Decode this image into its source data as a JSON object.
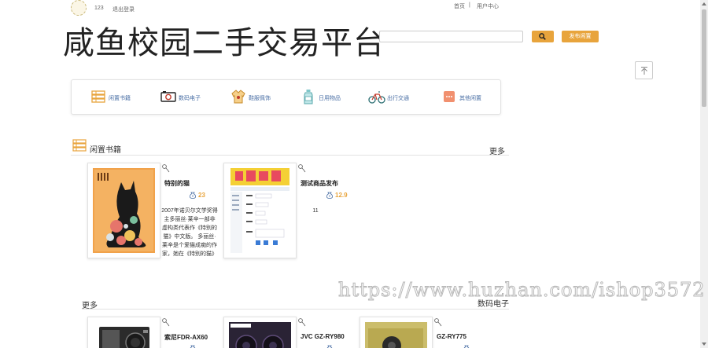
{
  "topbar": {
    "username": "123",
    "logout": "退出登录",
    "home": "首页",
    "separator": "|",
    "user_center": "用户中心"
  },
  "header": {
    "site_title": "咸鱼校园二手交易平台",
    "search_placeholder": "",
    "publish_label": "发布闲置"
  },
  "categories": [
    {
      "label": "闲置书籍",
      "icon": "books-icon"
    },
    {
      "label": "数码电子",
      "icon": "camera-icon"
    },
    {
      "label": "鞋服佩饰",
      "icon": "clothes-icon"
    },
    {
      "label": "日用物品",
      "icon": "bottle-icon"
    },
    {
      "label": "出行交通",
      "icon": "bicycle-icon"
    },
    {
      "label": "其他闲置",
      "icon": "other-icon"
    }
  ],
  "sections": {
    "books": {
      "title": "闲置书籍",
      "more": "更多",
      "products": [
        {
          "title": "特别的猫",
          "price": "23",
          "description": "2007年诺贝尔文学奖得主多丽丝·莱辛一部非虚构类代表作《特别的猫》中文版。 多丽丝·莱辛是个爱猫成痴的作家，她在《特别的猫》里讲述了人与猫之间..."
        },
        {
          "title": "测试商品发布",
          "price": "12.9",
          "description": "11"
        }
      ]
    },
    "digital": {
      "more": "更多",
      "title": "数码电子",
      "products": [
        {
          "title": "索尼FDR-AX60"
        },
        {
          "title": "JVC GZ-RY980"
        },
        {
          "title": "GZ-RY775"
        }
      ]
    }
  },
  "watermark": "https://www.huzhan.com/ishop3572",
  "colors": {
    "accent": "#e8a43c",
    "category_text": "#4a6fa5"
  }
}
